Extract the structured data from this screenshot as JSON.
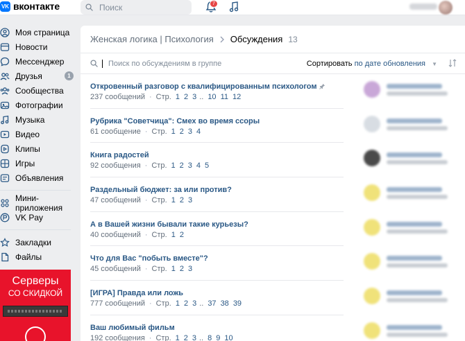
{
  "header": {
    "logo_mark": "VK",
    "logo_text": "вконтакте",
    "search_placeholder": "Поиск",
    "notifications_count": "7"
  },
  "sidebar": {
    "items": [
      {
        "label": "Моя страница",
        "icon": "profile-icon"
      },
      {
        "label": "Новости",
        "icon": "news-icon"
      },
      {
        "label": "Мессенджер",
        "icon": "messenger-icon"
      },
      {
        "label": "Друзья",
        "icon": "friends-icon",
        "badge": "1"
      },
      {
        "label": "Сообщества",
        "icon": "communities-icon"
      },
      {
        "label": "Фотографии",
        "icon": "photos-icon"
      },
      {
        "label": "Музыка",
        "icon": "music-icon"
      },
      {
        "label": "Видео",
        "icon": "video-icon"
      },
      {
        "label": "Клипы",
        "icon": "clips-icon"
      },
      {
        "label": "Игры",
        "icon": "games-icon"
      },
      {
        "label": "Объявления",
        "icon": "ads-icon"
      }
    ],
    "items2": [
      {
        "label": "Мини-приложения",
        "icon": "apps-icon"
      },
      {
        "label": "VK Pay",
        "icon": "vkpay-icon"
      }
    ],
    "items3": [
      {
        "label": "Закладки",
        "icon": "bookmark-icon"
      },
      {
        "label": "Файлы",
        "icon": "files-icon"
      }
    ],
    "ad": {
      "line1": "Серверы",
      "line2": "СО СКИДКОЙ"
    }
  },
  "breadcrumb": {
    "group": "Женская логика | Психология",
    "current": "Обсуждения",
    "count": "13"
  },
  "toolbar": {
    "search_placeholder": "Поиск по обсуждениям в группе",
    "sort_label": "Сортировать",
    "sort_value": "по дате обновления"
  },
  "topics": [
    {
      "title": "Откровенный разговор с квалифицированным психологом",
      "pinned": true,
      "messages": "237 сообщений",
      "pages": [
        "1",
        "2",
        "3",
        "..",
        "10",
        "11",
        "12"
      ]
    },
    {
      "title": "Рубрика \"Советчица\": Смех во время ссоры",
      "messages": "61 сообщение",
      "pages": [
        "1",
        "2",
        "3",
        "4"
      ]
    },
    {
      "title": "Книга радостей",
      "messages": "92 сообщения",
      "pages": [
        "1",
        "2",
        "3",
        "4",
        "5"
      ]
    },
    {
      "title": "Раздельный бюджет: за или против?",
      "messages": "47 сообщений",
      "pages": [
        "1",
        "2",
        "3"
      ]
    },
    {
      "title": "А в Вашей жизни бывали такие курьезы?",
      "messages": "40 сообщений",
      "pages": [
        "1",
        "2"
      ]
    },
    {
      "title": "Что для Вас \"побыть вместе\"?",
      "messages": "45 сообщений",
      "pages": [
        "1",
        "2",
        "3"
      ]
    },
    {
      "title": "[ИГРА] Правда или ложь",
      "messages": "777 сообщений",
      "pages": [
        "1",
        "2",
        "3",
        "..",
        "37",
        "38",
        "39"
      ]
    },
    {
      "title": "Ваш любимый фильм",
      "messages": "192 сообщения",
      "pages": [
        "1",
        "2",
        "3",
        "..",
        "8",
        "9",
        "10"
      ]
    }
  ],
  "pages_label": "Стр.",
  "avatar_colors": [
    "#c9a7d8",
    "#d8dde3",
    "#4a4a4a",
    "#f0e27a",
    "#f0e27a",
    "#f0e27a",
    "#f0e27a",
    "#f0e27a"
  ]
}
